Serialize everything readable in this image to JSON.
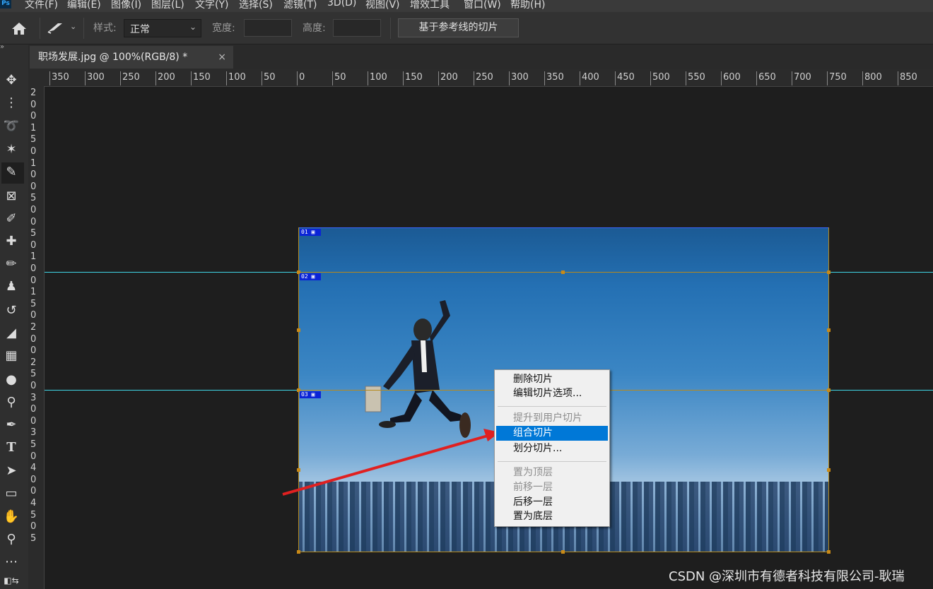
{
  "menubar": {
    "logo": "Ps",
    "items": [
      "文件(F)",
      "编辑(E)",
      "图像(I)",
      "图层(L)",
      "文字(Y)",
      "选择(S)",
      "滤镜(T)",
      "3D(D)",
      "视图(V)",
      "增效工具",
      "窗口(W)",
      "帮助(H)"
    ]
  },
  "options": {
    "style_label": "样式:",
    "style_value": "正常",
    "width_label": "宽度:",
    "height_label": "高度:",
    "slice_guides_button": "基于参考线的切片"
  },
  "tab": {
    "title": "职场发展.jpg @ 100%(RGB/8) *",
    "close": "×"
  },
  "ruler": {
    "h_labels": [
      "350",
      "300",
      "250",
      "200",
      "150",
      "100",
      "50",
      "0",
      "50",
      "100",
      "150",
      "200",
      "250",
      "300",
      "350",
      "400",
      "450",
      "500",
      "550",
      "600",
      "650",
      "700",
      "750",
      "800",
      "850"
    ],
    "v_labels": [
      "2",
      "0",
      "0",
      "1",
      "5",
      "0",
      "1",
      "0",
      "0",
      "5",
      "0",
      "0",
      "5",
      "0",
      "1",
      "0",
      "0",
      "1",
      "5",
      "0",
      "2",
      "0",
      "0",
      "2",
      "5",
      "0",
      "3",
      "0",
      "0",
      "3",
      "5",
      "0",
      "4",
      "0",
      "0",
      "4",
      "5",
      "0",
      "5"
    ]
  },
  "slices": {
    "badges": [
      "01",
      "02",
      "03"
    ],
    "colors": {
      "guide": "#3fd6e6",
      "slice": "#b78a1c",
      "badge": "#0b24d6"
    }
  },
  "context_menu": {
    "items": [
      {
        "label": "删除切片",
        "disabled": false
      },
      {
        "label": "编辑切片选项...",
        "disabled": false
      },
      {
        "label": "提升到用户切片",
        "disabled": true
      },
      {
        "label": "组合切片",
        "disabled": false,
        "highlighted": true
      },
      {
        "label": "划分切片...",
        "disabled": false
      },
      {
        "label": "置为顶层",
        "disabled": true
      },
      {
        "label": "前移一层",
        "disabled": true
      },
      {
        "label": "后移一层",
        "disabled": false
      },
      {
        "label": "置为底层",
        "disabled": false
      }
    ]
  },
  "watermark": "CSDN @深圳市有德者科技有限公司-耿瑞",
  "tools": [
    "move-icon",
    "marquee-icon",
    "lasso-icon",
    "magic-wand-icon",
    "slice-icon",
    "frame-icon",
    "eyedropper-icon",
    "healing-icon",
    "brush-icon",
    "stamp-icon",
    "history-brush-icon",
    "eraser-icon",
    "gradient-icon",
    "blur-icon",
    "dodge-icon",
    "pen-icon",
    "type-icon",
    "path-select-icon",
    "rectangle-icon",
    "hand-icon",
    "zoom-icon",
    "more-icon"
  ]
}
